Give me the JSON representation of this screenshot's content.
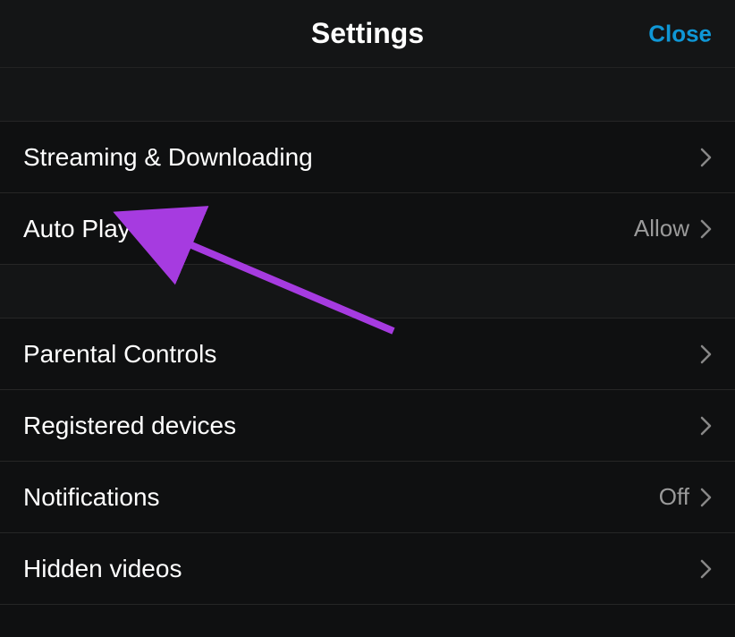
{
  "header": {
    "title": "Settings",
    "close_label": "Close"
  },
  "sections": [
    {
      "rows": [
        {
          "label": "Streaming & Downloading",
          "value": ""
        },
        {
          "label": "Auto Play",
          "value": "Allow"
        }
      ]
    },
    {
      "rows": [
        {
          "label": "Parental Controls",
          "value": ""
        },
        {
          "label": "Registered devices",
          "value": ""
        },
        {
          "label": "Notifications",
          "value": "Off"
        },
        {
          "label": "Hidden videos",
          "value": ""
        }
      ]
    }
  ],
  "annotation": {
    "color": "#a63be0",
    "target_row": "Auto Play"
  }
}
